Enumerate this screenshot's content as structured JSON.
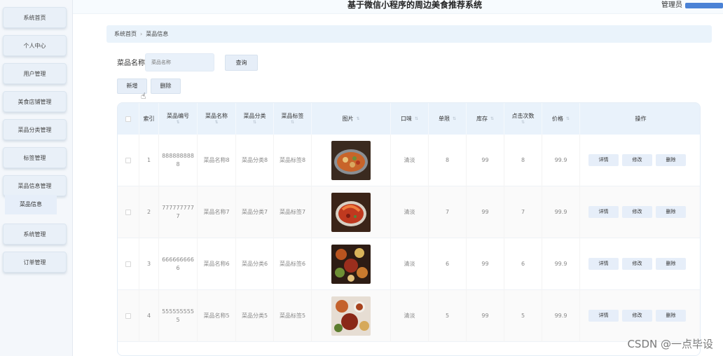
{
  "header": {
    "title": "基于微信小程序的周边美食推荐系统",
    "admin": "管理员"
  },
  "sidebar": {
    "items": [
      {
        "label": "系统首页"
      },
      {
        "label": "个人中心"
      },
      {
        "label": "用户管理"
      },
      {
        "label": "美食店铺管理"
      },
      {
        "label": "菜品分类管理"
      },
      {
        "label": "标签管理"
      },
      {
        "label": "菜品信息管理"
      },
      {
        "label": "系统管理"
      },
      {
        "label": "订单管理"
      }
    ],
    "active_sub": "菜品信息"
  },
  "breadcrumb": {
    "home": "系统首页",
    "current": "菜品信息"
  },
  "search": {
    "label": "菜品名称",
    "placeholder": "菜品名称",
    "button": "查询"
  },
  "toolbar": {
    "add": "新增",
    "delete": "删除"
  },
  "table": {
    "columns": [
      "",
      "索引",
      "菜品编号",
      "菜品名称",
      "菜品分类",
      "菜品标签",
      "图片",
      "口味",
      "单限",
      "库存",
      "点击次数",
      "价格",
      "操作"
    ],
    "row_actions": {
      "detail": "详情",
      "edit": "修改",
      "delete": "删除"
    },
    "rows": [
      {
        "index": "1",
        "code": "888888888 8",
        "name": "菜品名称8",
        "category": "菜品分类8",
        "tag": "菜品标签8",
        "taste": "清淡",
        "limit": "8",
        "stock": "99",
        "clicks": "8",
        "price": "99.9",
        "img": "hotpot"
      },
      {
        "index": "2",
        "code": "777777777 7",
        "name": "菜品名称7",
        "category": "菜品分类7",
        "tag": "菜品标签7",
        "taste": "清淡",
        "limit": "7",
        "stock": "99",
        "clicks": "7",
        "price": "99.9",
        "img": "shrimp"
      },
      {
        "index": "3",
        "code": "666666666 6",
        "name": "菜品名称6",
        "category": "菜品分类6",
        "tag": "菜品标签6",
        "taste": "清淡",
        "limit": "6",
        "stock": "99",
        "clicks": "6",
        "price": "99.9",
        "img": "platter"
      },
      {
        "index": "4",
        "code": "555555555 5",
        "name": "菜品名称5",
        "category": "菜品分类5",
        "tag": "菜品标签5",
        "taste": "清淡",
        "limit": "5",
        "stock": "99",
        "clicks": "5",
        "price": "99.9",
        "img": "dishes"
      }
    ]
  },
  "watermark": "CSDN @一点毕设",
  "colors": {
    "accent": "#4a82d6",
    "header_bg": "#e9f2fb",
    "button_bg": "#e6eef8"
  }
}
